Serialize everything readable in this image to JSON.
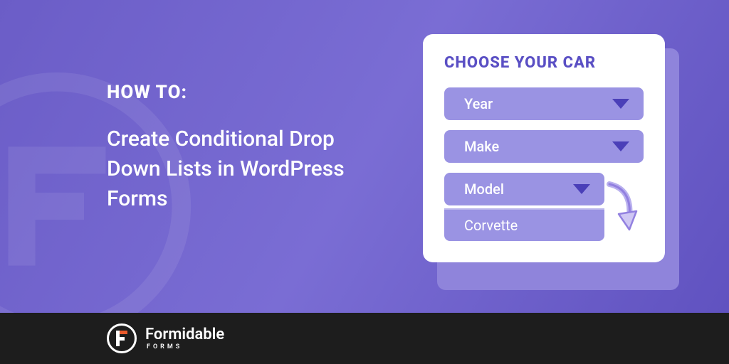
{
  "hero": {
    "label": "HOW TO:",
    "title": "Create Conditional Drop Down Lists in WordPress Forms"
  },
  "card": {
    "heading": "CHOOSE YOUR CAR",
    "dropdowns": [
      {
        "label": "Year"
      },
      {
        "label": "Make"
      },
      {
        "label": "Model"
      }
    ],
    "expanded_option": "Corvette"
  },
  "footer": {
    "brand": "Formidable",
    "sub": "FORMS"
  }
}
